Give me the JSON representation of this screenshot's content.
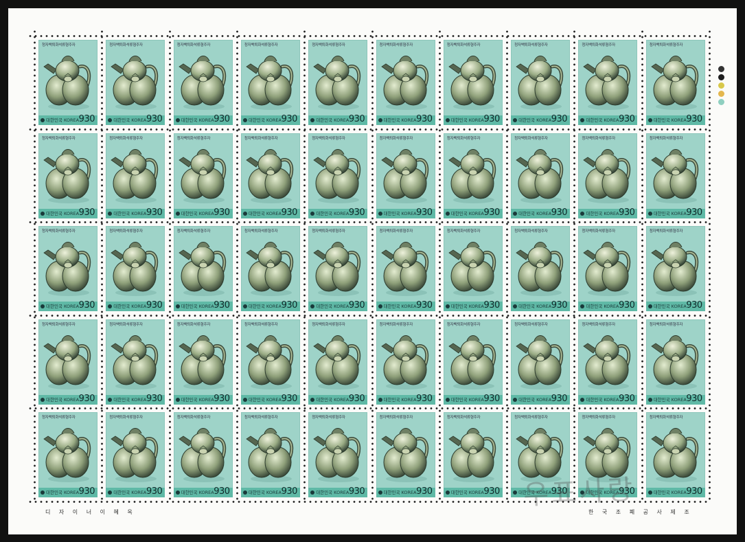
{
  "sheet": {
    "rows": 5,
    "columns": 10,
    "stamp": {
      "caption": "청자백퇴화석류형주자",
      "country": "대한민국 KOREA",
      "value": "930"
    },
    "footer_left": "디 자 이 너   이 혜 옥",
    "footer_right": "한 국 조 폐 공 사 제 조",
    "watermark": "우표사랑",
    "colors": {
      "stamp_background": "#9ed3c8",
      "bottom_bar": "#5fb9a6",
      "sheet": "#fbfbf9",
      "color_dots": [
        "#333333",
        "#1d1d1d",
        "#d8c84a",
        "#e4b74e",
        "#8fcfc0"
      ]
    }
  }
}
